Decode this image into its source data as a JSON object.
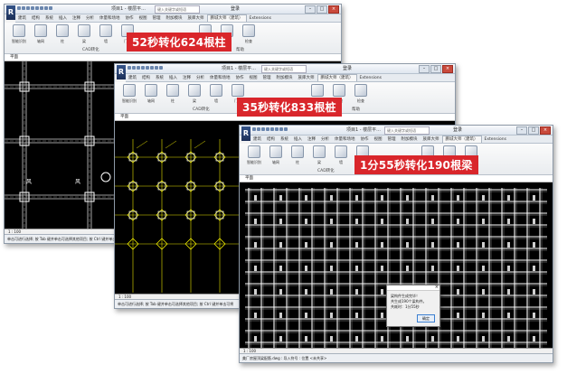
{
  "window1": {
    "title": "项目1 - 楼层平...",
    "search_placeholder": "键入关键字或短语",
    "login": "登录",
    "tabs": [
      "建筑",
      "结构",
      "系统",
      "插入",
      "注释",
      "分析",
      "体量和场地",
      "协作",
      "视图",
      "管理",
      "附加模块",
      "族库大师",
      "鹏城大师（建筑）",
      "Extensions"
    ],
    "ribbon_buttons": [
      "智能识别",
      "轴网",
      "柱",
      "梁",
      "墙",
      "门窗",
      "定位",
      "提取",
      "检查"
    ],
    "panel_label": "CAD转化",
    "panel_label_2": "帮助",
    "prop_text": "平面",
    "canvas_text": "风",
    "scale": "1 : 100",
    "status": "单击可进行选择; 按 Tab 键并单击可选择其他项目; 按 Ctrl 键并单击可将"
  },
  "window2": {
    "title": "项目1 - 楼层平...",
    "search_placeholder": "键入关键字或短语",
    "login": "登录",
    "tabs": [
      "建筑",
      "结构",
      "系统",
      "插入",
      "注释",
      "分析",
      "体量和场地",
      "协作",
      "视图",
      "管理",
      "附加模块",
      "族库大师",
      "鹏城大师（建筑）",
      "Extensions"
    ],
    "ribbon_buttons": [
      "智能识别",
      "轴网",
      "柱",
      "梁",
      "墙",
      "门窗",
      "定位",
      "提取",
      "检查"
    ],
    "panel_label": "CAD转化",
    "panel_label_2": "帮助",
    "prop_text": "平面",
    "scale": "1 : 100",
    "status": "单击可进行选择; 按 Tab 键并单击可选择其他项目; 按 Ctrl 键并单击可将"
  },
  "window3": {
    "title": "项目1 - 楼层平...",
    "search_placeholder": "键入关键字或短语",
    "login": "登录",
    "tabs": [
      "建筑",
      "结构",
      "系统",
      "插入",
      "注释",
      "分析",
      "体量和场地",
      "协作",
      "视图",
      "管理",
      "附加模块",
      "族库大师",
      "鹏城大师（建筑）",
      "Extensions"
    ],
    "ribbon_buttons": [
      "智能识别",
      "轴网",
      "柱",
      "梁",
      "墙",
      "门窗",
      "定位",
      "提取",
      "检查"
    ],
    "panel_label": "CAD转化",
    "panel_label_2": "帮助",
    "prop_text": "平面",
    "scale": "1 : 100",
    "status": "美厂房屋顶梁配筋.dwg : 导入符号 : 位置 <未共享>"
  },
  "banners": {
    "b1": "52秒转化624根柱",
    "b2": "35秒转化833根桩",
    "b3": "1分55秒转化190根梁"
  },
  "dialog": {
    "line1": "梁构件生成完毕！",
    "line2": "共生成190个梁构件。",
    "line3": "共耗时：1分55秒",
    "ok": "确定"
  },
  "colors": {
    "banner_red": "#d9262b",
    "canvas_bg": "#000000",
    "cad_yellow": "#e8e400",
    "cad_white": "#ffffff"
  }
}
